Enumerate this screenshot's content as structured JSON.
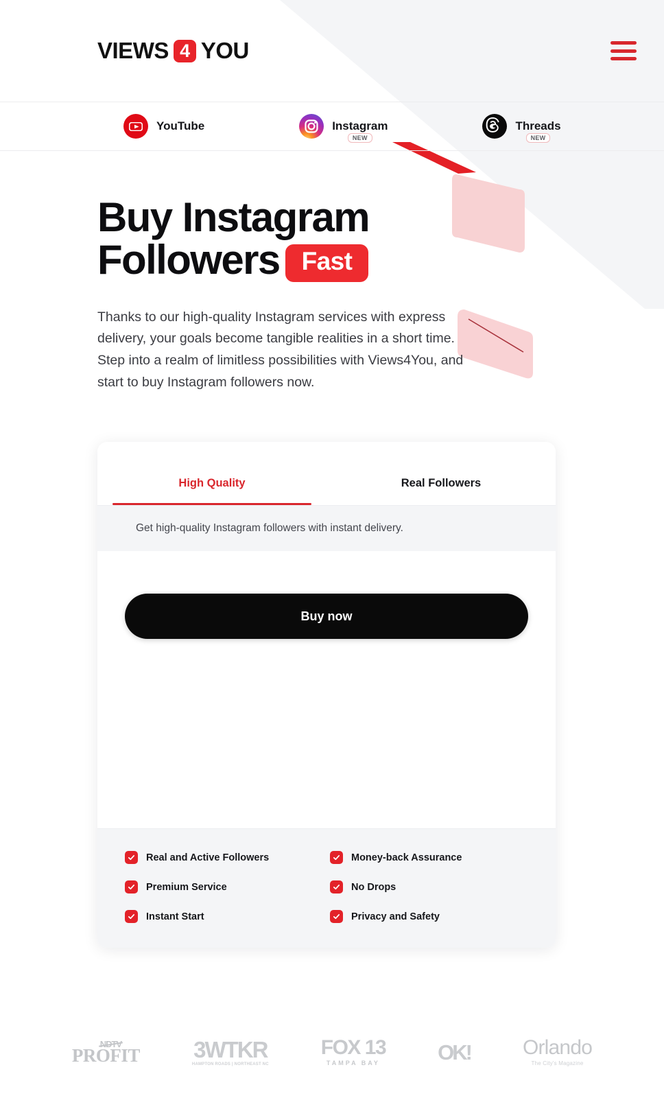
{
  "brand": {
    "logo_part1": "VIEWS",
    "logo_accent": "4",
    "logo_part2": "YOU",
    "accent_color": "#e8242a",
    "menu_icon": "hamburger-icon"
  },
  "platform_nav": {
    "items": [
      {
        "label": "YouTube",
        "icon": "youtube-icon",
        "badge": ""
      },
      {
        "label": "Instagram",
        "icon": "instagram-icon",
        "badge": "NEW"
      },
      {
        "label": "Threads",
        "icon": "threads-icon",
        "badge": "NEW"
      }
    ]
  },
  "hero": {
    "title_line1": "Buy Instagram",
    "title_line2": "Followers",
    "title_pill": "Fast",
    "paragraph": "Thanks to our high-quality Instagram services with express delivery, your goals become tangible realities in a short time. Step into a realm of limitless possibilities with Views4You, and start to buy Instagram followers now."
  },
  "card": {
    "tabs": [
      {
        "label": "High Quality",
        "active": true
      },
      {
        "label": "Real Followers",
        "active": false
      }
    ],
    "subnote": "Get high-quality Instagram followers with instant delivery.",
    "buy_button": "Buy now",
    "features": [
      "Real and Active Followers",
      "Money-back Assurance",
      "Premium Service",
      "No Drops",
      "Instant Start",
      "Privacy and Safety"
    ]
  },
  "press": {
    "logos": [
      {
        "name": "ndtv-profit-logo",
        "top": "NDTV",
        "main": "PROFIT",
        "sub": ""
      },
      {
        "name": "wtkr-logo",
        "main": "3WTKR",
        "sub": "HAMPTON ROADS | NORTHEAST NC"
      },
      {
        "name": "fox13-logo",
        "main": "FOX 13",
        "sub": "TAMPA BAY"
      },
      {
        "name": "ok-magazine-logo",
        "main": "OK!",
        "sub": ""
      },
      {
        "name": "orlando-magazine-logo",
        "main": "Orlando",
        "sub": "The City's Magazine"
      }
    ]
  }
}
